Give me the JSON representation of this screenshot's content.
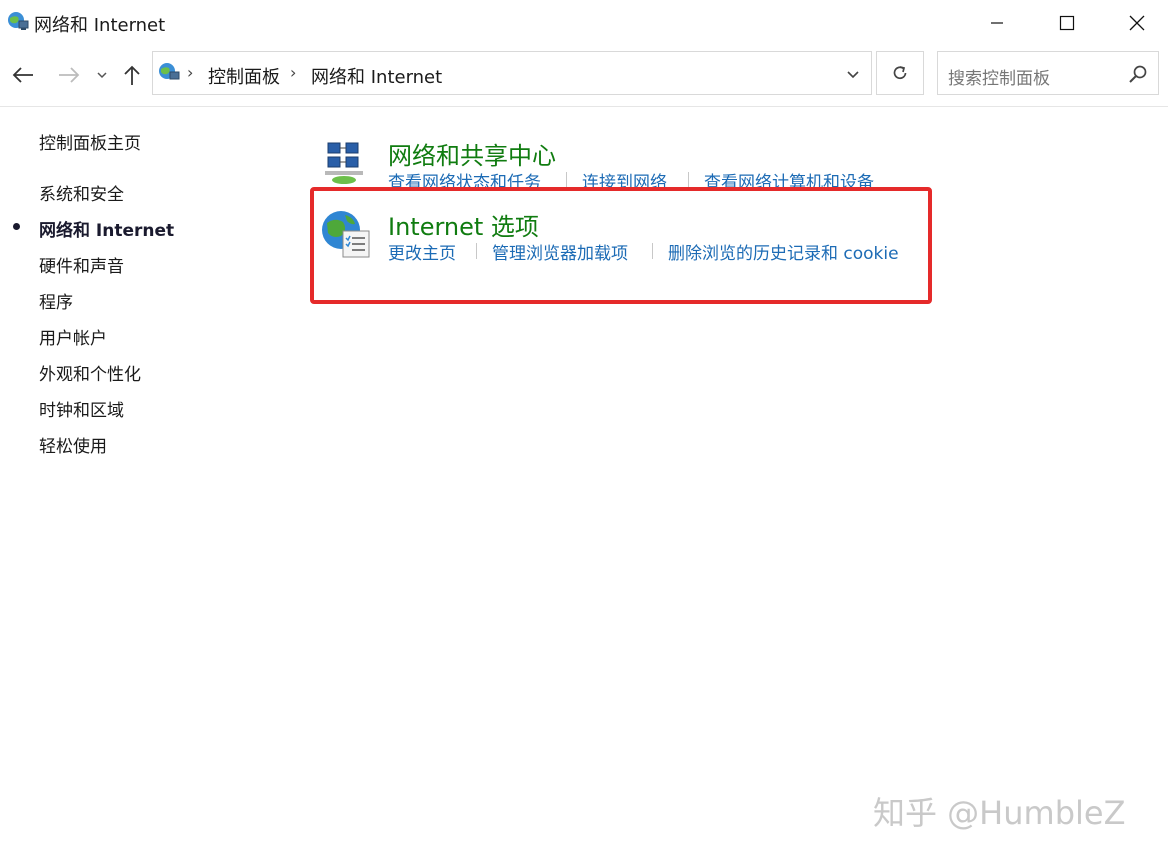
{
  "window": {
    "title": "网络和 Internet"
  },
  "navbar": {
    "breadcrumb": [
      "控制面板",
      "网络和 Internet"
    ],
    "search_placeholder": "搜索控制面板"
  },
  "sidebar": {
    "items": [
      {
        "label": "控制面板主页"
      },
      {
        "label": "系统和安全"
      },
      {
        "label": "网络和 Internet",
        "active": true
      },
      {
        "label": "硬件和声音"
      },
      {
        "label": "程序"
      },
      {
        "label": "用户帐户"
      },
      {
        "label": "外观和个性化"
      },
      {
        "label": "时钟和区域"
      },
      {
        "label": "轻松使用"
      }
    ]
  },
  "categories": [
    {
      "title": "网络和共享中心",
      "icon": "network-sharing-icon",
      "links": [
        "查看网络状态和任务",
        "连接到网络",
        "查看网络计算机和设备"
      ]
    },
    {
      "title": "Internet 选项",
      "icon": "internet-options-globe-icon",
      "links": [
        "更改主页",
        "管理浏览器加载项",
        "删除浏览的历史记录和 cookie"
      ]
    }
  ],
  "watermark": "知乎 @HumbleZ",
  "colors": {
    "category_title": "#107c10",
    "link": "#1c6bb5",
    "highlight": "#e52a2a"
  }
}
